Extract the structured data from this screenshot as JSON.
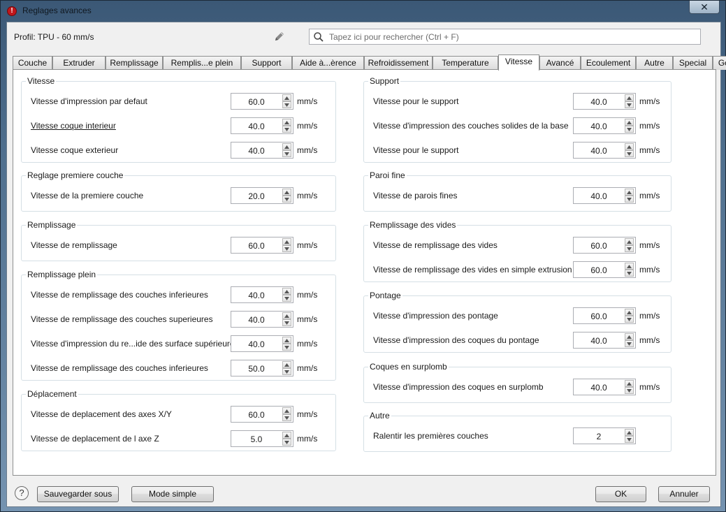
{
  "window": {
    "title": "Reglages avances",
    "close_glyph": "✕"
  },
  "profile": {
    "label": "Profil: TPU - 60 mm/s"
  },
  "search": {
    "placeholder": "Tapez ici pour rechercher (Ctrl + F)",
    "value": ""
  },
  "tabs": [
    {
      "label": "Couche"
    },
    {
      "label": "Extruder"
    },
    {
      "label": "Remplissage"
    },
    {
      "label": "Remplis...e plein"
    },
    {
      "label": "Support"
    },
    {
      "label": "Aide à...èrence"
    },
    {
      "label": "Refroidissement"
    },
    {
      "label": "Temperature"
    },
    {
      "label": "Vitesse",
      "active": true
    },
    {
      "label": "Avancé"
    },
    {
      "label": "Ecoulement"
    },
    {
      "label": "Autre"
    },
    {
      "label": "Special"
    },
    {
      "label": "Gcode"
    }
  ],
  "groups": {
    "vitesse": {
      "title": "Vitesse",
      "rows": [
        {
          "label": "Vitesse d'impression par defaut",
          "value": "60.0",
          "unit": "mm/s"
        },
        {
          "label": "Vitesse coque interieur",
          "value": "40.0",
          "unit": "mm/s"
        },
        {
          "label": "Vitesse coque exterieur",
          "value": "40.0",
          "unit": "mm/s"
        }
      ]
    },
    "premiere_couche": {
      "title": "Reglage premiere couche",
      "rows": [
        {
          "label": "Vitesse de la premiere couche",
          "value": "20.0",
          "unit": "mm/s"
        }
      ]
    },
    "remplissage": {
      "title": "Remplissage",
      "rows": [
        {
          "label": "Vitesse de remplissage",
          "value": "60.0",
          "unit": "mm/s"
        }
      ]
    },
    "remplissage_plein": {
      "title": "Remplissage plein",
      "rows": [
        {
          "label": "Vitesse de remplissage des couches inferieures",
          "value": "40.0",
          "unit": "mm/s"
        },
        {
          "label": "Vitesse de remplissage des couches superieures",
          "value": "40.0",
          "unit": "mm/s"
        },
        {
          "label": "Vitesse d'impression du re...ide des surface supérieure",
          "value": "40.0",
          "unit": "mm/s"
        },
        {
          "label": "Vitesse de remplissage des couches inferieures",
          "value": "50.0",
          "unit": "mm/s"
        }
      ]
    },
    "deplacement": {
      "title": "Déplacement",
      "rows": [
        {
          "label": "Vitesse de deplacement des axes X/Y",
          "value": "60.0",
          "unit": "mm/s"
        },
        {
          "label": "Vitesse de deplacement de l axe Z",
          "value": "5.0",
          "unit": "mm/s"
        }
      ]
    },
    "support": {
      "title": "Support",
      "rows": [
        {
          "label": "Vitesse pour le support",
          "value": "40.0",
          "unit": "mm/s"
        },
        {
          "label": "Vitesse d'impression des couches solides de la base",
          "value": "40.0",
          "unit": "mm/s"
        },
        {
          "label": "Vitesse pour le support",
          "value": "40.0",
          "unit": "mm/s"
        }
      ]
    },
    "paroi_fine": {
      "title": "Paroi fine",
      "rows": [
        {
          "label": "Vitesse de parois fines",
          "value": "40.0",
          "unit": "mm/s"
        }
      ]
    },
    "vides": {
      "title": "Remplissage des vides",
      "rows": [
        {
          "label": "Vitesse de remplissage des vides",
          "value": "60.0",
          "unit": "mm/s"
        },
        {
          "label": "Vitesse de remplissage des vides en simple extrusion",
          "value": "60.0",
          "unit": "mm/s"
        }
      ]
    },
    "pontage": {
      "title": "Pontage",
      "rows": [
        {
          "label": "Vitesse d'impression des pontage",
          "value": "60.0",
          "unit": "mm/s"
        },
        {
          "label": "Vitesse d'impression des coques du pontage",
          "value": "40.0",
          "unit": "mm/s"
        }
      ]
    },
    "surplomb": {
      "title": "Coques en surplomb",
      "rows": [
        {
          "label": "Vitesse d'impression des coques en surplomb",
          "value": "40.0",
          "unit": "mm/s"
        }
      ]
    },
    "autre": {
      "title": "Autre",
      "rows": [
        {
          "label": "Ralentir les premières couches",
          "value": "2",
          "unit": ""
        }
      ]
    }
  },
  "footer": {
    "help_glyph": "?",
    "save_as": "Sauvegarder sous",
    "simple_mode": "Mode simple",
    "ok": "OK",
    "cancel": "Annuler"
  },
  "colors": {
    "group_border": "#d5dfe5",
    "title_accent": "#c0171c"
  }
}
